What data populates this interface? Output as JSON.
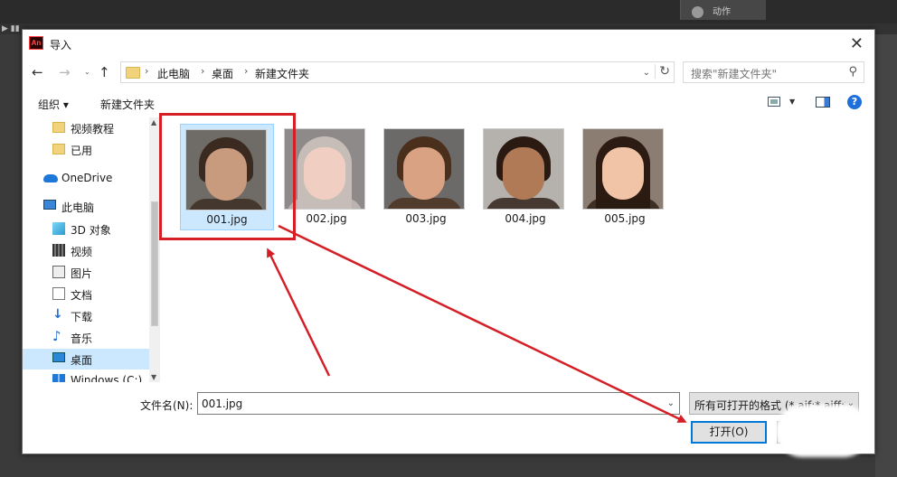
{
  "background_app": {
    "panel_label": "动作"
  },
  "dialog": {
    "app_icon_text": "An",
    "title": "导入",
    "close_label": "✕"
  },
  "navigation": {
    "breadcrumbs": [
      "此电脑",
      "桌面",
      "新建文件夹"
    ],
    "search_placeholder": "搜索\"新建文件夹\""
  },
  "toolbar": {
    "organize_label": "组织 ▾",
    "new_folder_label": "新建文件夹"
  },
  "sidebar": {
    "items": [
      {
        "label": "视频教程",
        "icon": "folder-icon"
      },
      {
        "label": "已用",
        "icon": "folder-icon"
      },
      {
        "label": "OneDrive",
        "icon": "onedrive-cloud-icon"
      },
      {
        "label": "此电脑",
        "icon": "this-pc-icon"
      },
      {
        "label": "3D 对象",
        "icon": "3d-objects-icon"
      },
      {
        "label": "视频",
        "icon": "video-icon"
      },
      {
        "label": "图片",
        "icon": "pictures-icon"
      },
      {
        "label": "文档",
        "icon": "documents-icon"
      },
      {
        "label": "下载",
        "icon": "download-icon"
      },
      {
        "label": "音乐",
        "icon": "music-icon"
      },
      {
        "label": "桌面",
        "icon": "desktop-icon",
        "selected": true
      },
      {
        "label": "Windows (C:)",
        "icon": "windows-drive-icon"
      }
    ]
  },
  "files": [
    {
      "name": "001.jpg",
      "selected": true,
      "skin": "#c89a7e",
      "hair": "#3a2a20",
      "bg": "#6f6b66"
    },
    {
      "name": "002.jpg",
      "selected": false,
      "skin": "#f0cfc2",
      "hair": "#c7bdb8",
      "bg": "#8e8a8a"
    },
    {
      "name": "003.jpg",
      "selected": false,
      "skin": "#d9a383",
      "hair": "#4a2f1d",
      "bg": "#6b6a68"
    },
    {
      "name": "004.jpg",
      "selected": false,
      "skin": "#b07a57",
      "hair": "#2a1a12",
      "bg": "#b5b2ad"
    },
    {
      "name": "005.jpg",
      "selected": false,
      "skin": "#f1c4a8",
      "hair": "#2b1b12",
      "bg": "#8b7d72"
    }
  ],
  "footer": {
    "filename_label": "文件名(N):",
    "filename_value": "001.jpg",
    "filetype_value": "所有可打开的格式 (*.aif;*.aiff;*",
    "open_button": "打开(O)"
  },
  "colors": {
    "annotation_red": "#d51f26",
    "selection_blue": "#cce8ff",
    "accent_blue": "#0078d7"
  }
}
